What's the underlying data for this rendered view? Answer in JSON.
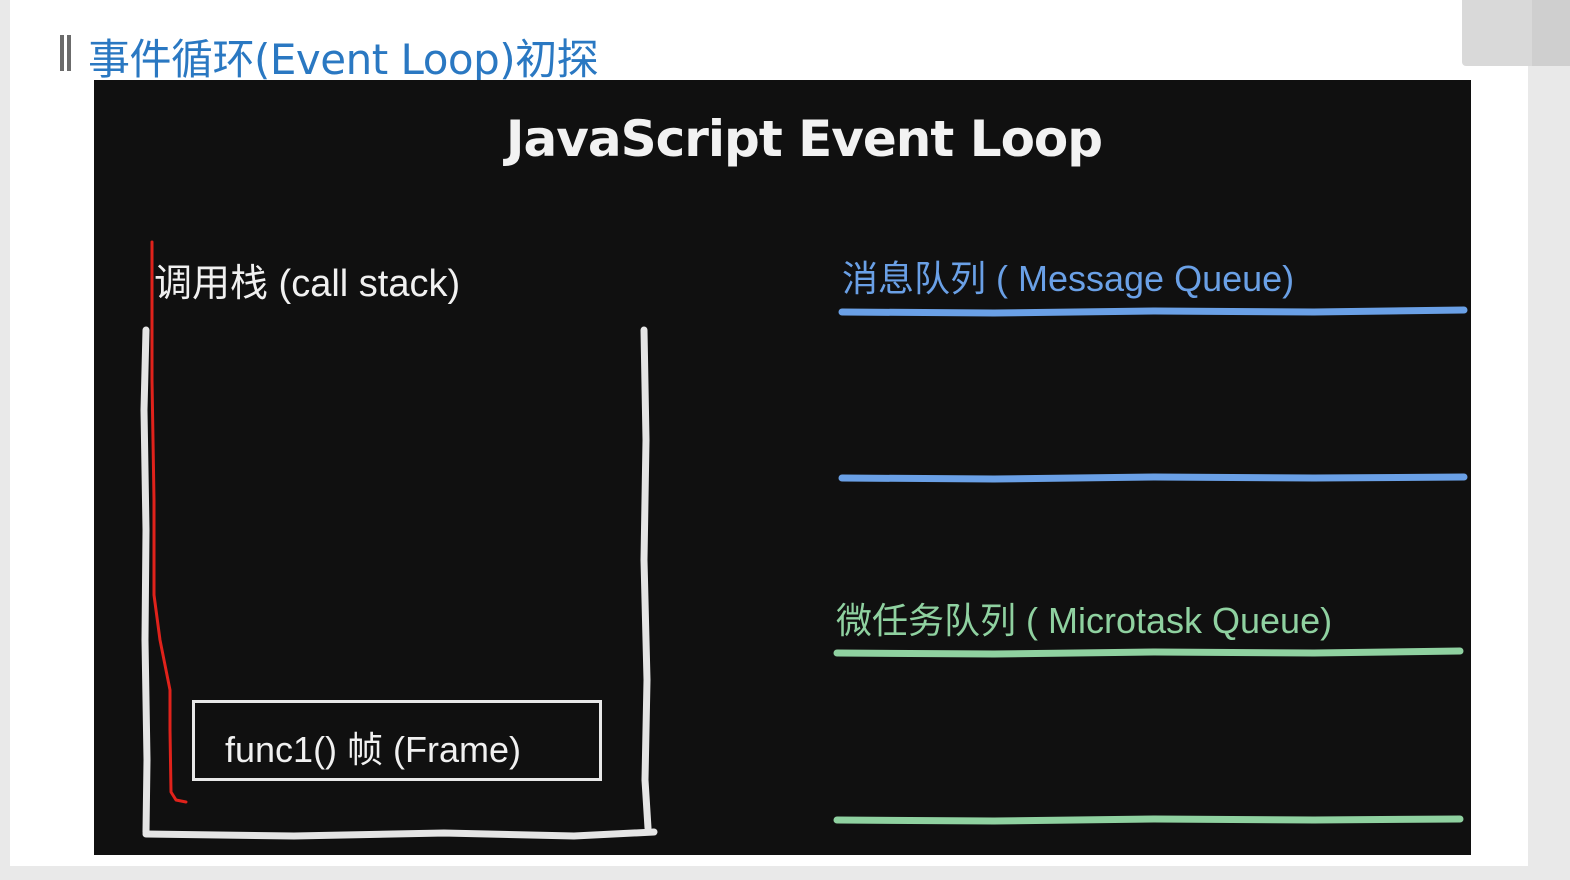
{
  "header": {
    "title": "事件循环(Event Loop)初探"
  },
  "slide": {
    "title": "JavaScript Event Loop",
    "call_stack": {
      "label": "调用栈 (call stack)",
      "frame_label": "func1()   帧 (Frame)"
    },
    "message_queue": {
      "label": "消息队列 ( Message Queue)",
      "color": "#6aa0e6"
    },
    "microtask_queue": {
      "label": "微任务队列 ( Microtask Queue)",
      "color": "#8fd1a0"
    },
    "annotation_color": "#e0221b"
  }
}
